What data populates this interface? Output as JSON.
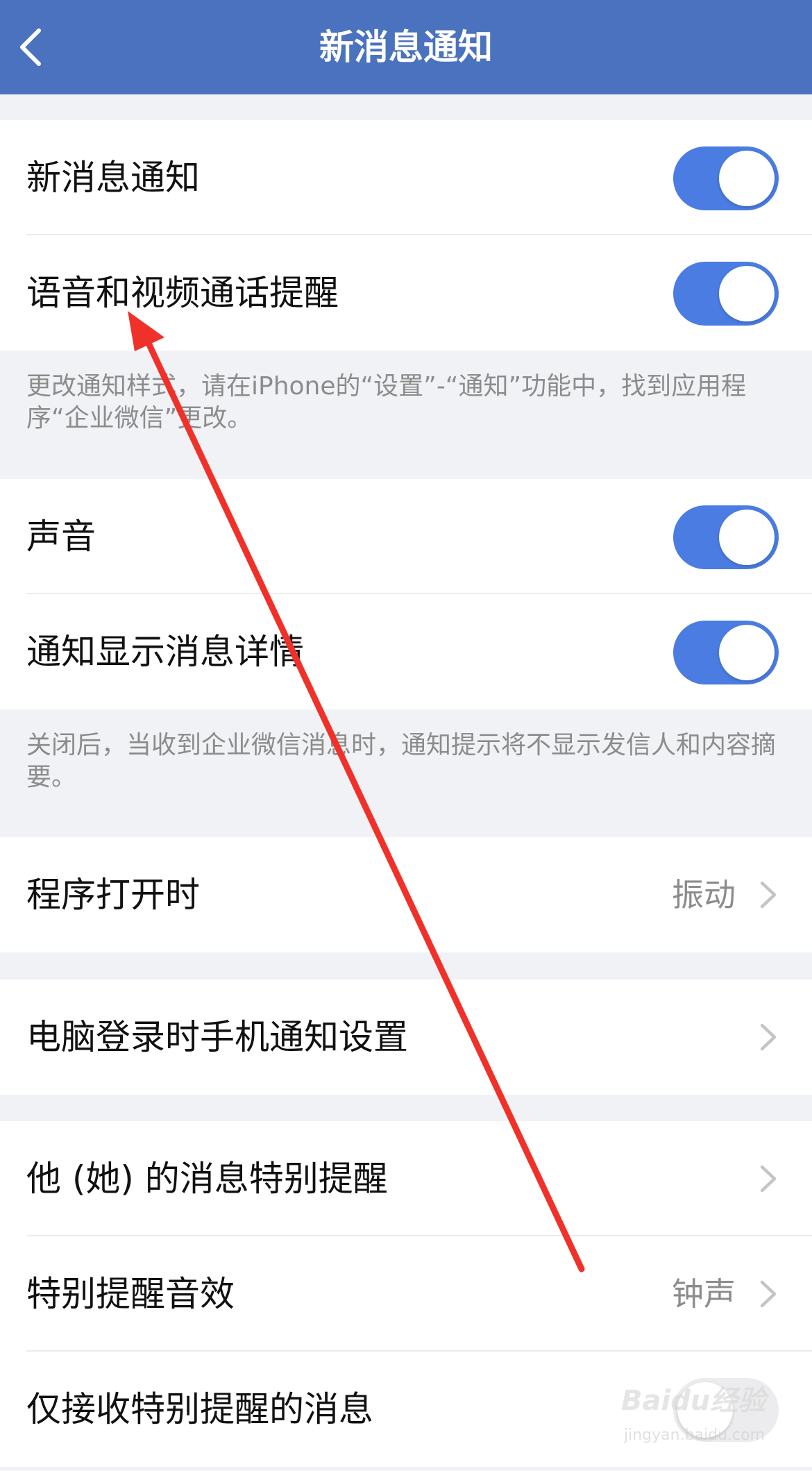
{
  "header": {
    "title": "新消息通知",
    "back_icon": "chevron-left-icon"
  },
  "group1": {
    "rows": [
      {
        "label": "新消息通知",
        "toggle": "on"
      },
      {
        "label": "语音和视频通话提醒",
        "toggle": "on"
      }
    ],
    "note": "更改通知样式，请在iPhone的“设置”-“通知”功能中，找到应用程序“企业微信”更改。"
  },
  "group2": {
    "rows": [
      {
        "label": "声音",
        "toggle": "on"
      },
      {
        "label": "通知显示消息详情",
        "toggle": "on"
      }
    ],
    "note": "关闭后，当收到企业微信消息时，通知提示将不显示发信人和内容摘要。"
  },
  "group3": {
    "label": "程序打开时",
    "value": "振动"
  },
  "group4": {
    "label": "电脑登录时手机通知设置"
  },
  "group5": {
    "rows": [
      {
        "label": "他 (她) 的消息特别提醒"
      },
      {
        "label": "特别提醒音效",
        "value": "钟声"
      },
      {
        "label": "仅接收特别提醒的消息",
        "toggle": "off"
      }
    ]
  },
  "watermark": {
    "brand": "Baidu经验",
    "url": "jingyan.baidu.com"
  },
  "colors": {
    "navbar": "#4a72be",
    "toggle_on": "#4a7ce2",
    "background": "#f1f2f5",
    "annotation_arrow": "#f0312a"
  }
}
